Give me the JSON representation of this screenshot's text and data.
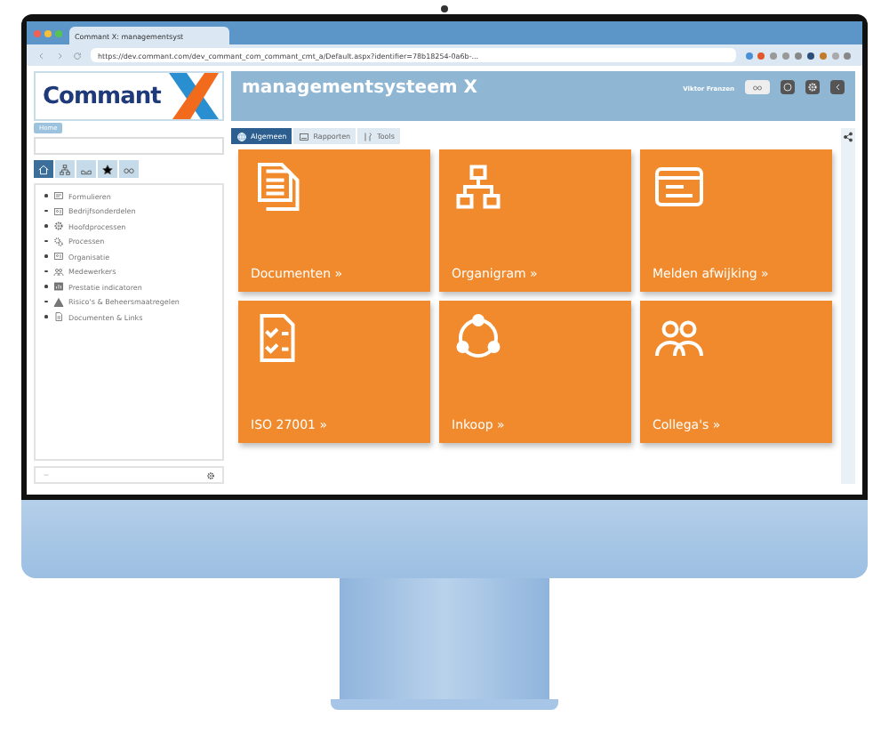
{
  "browser": {
    "tab_title": "Commant X: managementsyst",
    "url": "https://dev.commant.com/dev_commant_com_commant_cmt_a/Default.aspx?identifier=78b18254-0a6b-..."
  },
  "app": {
    "logo": "Commant",
    "title": "managementsysteem X",
    "user": "Viktor Franzen"
  },
  "sidebar": {
    "tooltip": "Home",
    "toolbar": [
      {
        "kind": "home",
        "selected": true
      },
      {
        "kind": "org",
        "selected": false
      },
      {
        "kind": "inbox",
        "selected": false
      },
      {
        "kind": "star",
        "selected": false
      },
      {
        "kind": "glasses",
        "selected": false
      }
    ],
    "items": [
      {
        "label": "Formulieren",
        "kind": "form"
      },
      {
        "label": "Bedrijfsonderdelen",
        "kind": "card"
      },
      {
        "label": "Hoofdprocessen",
        "kind": "gear"
      },
      {
        "label": "Processen",
        "kind": "gears"
      },
      {
        "label": "Organisatie",
        "kind": "card"
      },
      {
        "label": "Medewerkers",
        "kind": "people"
      },
      {
        "label": "Prestatie indicatoren",
        "kind": "chart"
      },
      {
        "label": "Risico's & Beheersmaatregelen",
        "kind": "warning"
      },
      {
        "label": "Documenten & Links",
        "kind": "doc"
      }
    ]
  },
  "tabs": [
    {
      "label": "Algemeen",
      "kind": "globe",
      "selected": true
    },
    {
      "label": "Rapporten",
      "kind": "report",
      "selected": false
    },
    {
      "label": "Tools",
      "kind": "tools",
      "selected": false
    }
  ],
  "tiles": [
    {
      "label": "Documenten »",
      "kind": "docs"
    },
    {
      "label": "Organigram »",
      "kind": "org"
    },
    {
      "label": "Melden afwijking »",
      "kind": "browser"
    },
    {
      "label": "ISO 27001 »",
      "kind": "checklist"
    },
    {
      "label": "Inkoop »",
      "kind": "ring"
    },
    {
      "label": "Collega's »",
      "kind": "people"
    }
  ]
}
